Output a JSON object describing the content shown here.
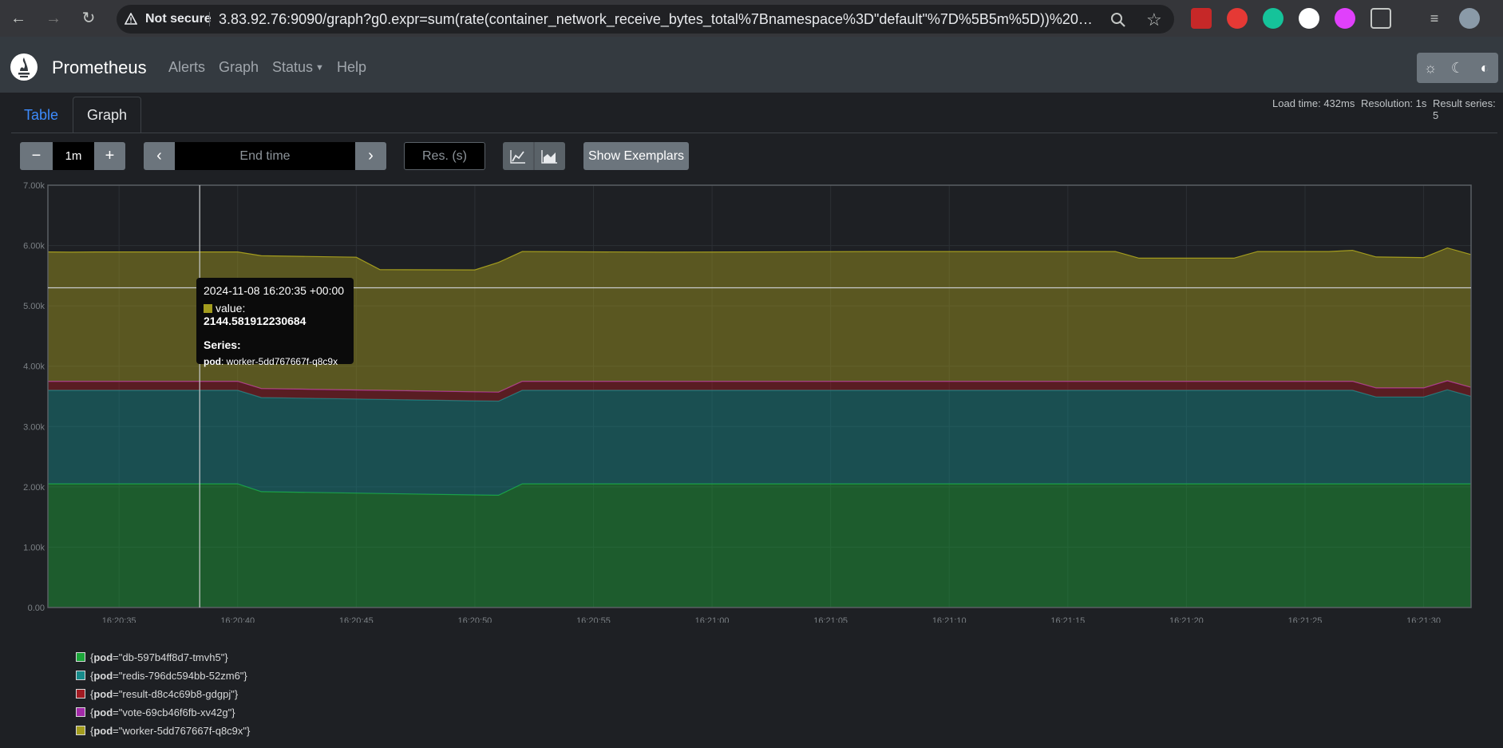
{
  "browser": {
    "security_label": "Not secure",
    "url": "3.83.92.76:9090/graph?g0.expr=sum(rate(container_network_receive_bytes_total%7Bnamespace%3D\"default\"%7D%5B5m%5D))%20by%20(p..."
  },
  "navbar": {
    "brand": "Prometheus",
    "links": [
      "Alerts",
      "Graph",
      "Status",
      "Help"
    ]
  },
  "tabs": {
    "table": "Table",
    "graph": "Graph"
  },
  "stats": {
    "load_time": "Load time: 432ms",
    "resolution": "Resolution: 1s",
    "result_series": "Result series: 5"
  },
  "controls": {
    "minus": "−",
    "range": "1m",
    "plus": "+",
    "prev": "‹",
    "end_time_placeholder": "End time",
    "next": "›",
    "res_placeholder": "Res. (s)",
    "show_exemplars": "Show Exemplars"
  },
  "tooltip": {
    "date": "2024-11-08 16:20:35 +00:00",
    "value_label": "value: ",
    "value": "2144.581912230684",
    "series_label": "Series:",
    "pod_key": "pod",
    "pod_value": "worker-5dd767667f-q8c9x"
  },
  "legend": [
    {
      "label_pre": "{",
      "key": "pod",
      "label_post": "=\"db-597b4ff8d7-tmvh5\"}",
      "color": "#1ca63a"
    },
    {
      "label_pre": "{",
      "key": "pod",
      "label_post": "=\"redis-796dc594bb-52zm6\"}",
      "color": "#168a8a"
    },
    {
      "label_pre": "{",
      "key": "pod",
      "label_post": "=\"result-d8c4c69b8-gdgpj\"}",
      "color": "#a11b22"
    },
    {
      "label_pre": "{",
      "key": "pod",
      "label_post": "=\"vote-69cb46f6fb-xv42g\"}",
      "color": "#a22aa8"
    },
    {
      "label_pre": "{",
      "key": "pod",
      "label_post": "=\"worker-5dd767667f-q8c9x\"}",
      "color": "#a39c1e"
    }
  ],
  "chart_data": {
    "type": "area",
    "stacked": true,
    "ylim": [
      0,
      7000
    ],
    "y_ticks": [
      "0.00",
      "1.00k",
      "2.00k",
      "3.00k",
      "4.00k",
      "5.00k",
      "6.00k",
      "7.00k"
    ],
    "x_ticks": [
      "16:20:35",
      "16:20:40",
      "16:20:45",
      "16:20:50",
      "16:20:55",
      "16:21:00",
      "16:21:05",
      "16:21:10",
      "16:21:15",
      "16:21:20",
      "16:21:25",
      "16:21:30"
    ],
    "x_seconds": [
      0,
      4,
      6,
      8,
      13,
      16,
      18,
      19,
      55,
      57,
      62,
      63,
      64,
      67,
      68,
      69
    ],
    "x_labels_seconds": [
      3,
      8,
      13,
      18,
      23,
      28,
      33,
      38,
      43,
      48,
      53,
      58
    ],
    "x_range_seconds": [
      0,
      60
    ],
    "crosshair": {
      "x_seconds": 6.4,
      "y": 5300
    },
    "series": [
      {
        "name": "{pod=\"db-597b4ff8d7-tmvh5\"}",
        "color": "#1ca63a",
        "x": [
          0,
          8,
          9,
          19,
          20,
          60
        ],
        "values": [
          2050,
          2050,
          1920,
          1860,
          2050,
          2050
        ]
      },
      {
        "name": "{pod=\"redis-796dc594bb-52zm6\"}",
        "color": "#168a8a",
        "x": [
          0,
          8,
          9,
          19,
          20,
          55,
          56,
          58,
          59,
          60
        ],
        "values": [
          1550,
          1550,
          1560,
          1560,
          1550,
          1550,
          1440,
          1440,
          1560,
          1450
        ]
      },
      {
        "name": "{pod=\"result-d8c4c69b8-gdgpj\"}",
        "color": "#a11b22",
        "x": [
          0,
          60
        ],
        "values": [
          150,
          150
        ]
      },
      {
        "name": "{pod=\"vote-69cb46f6fb-xv42g\"}",
        "color": "#a22aa8",
        "x": [
          0,
          60
        ],
        "values": [
          0,
          0
        ]
      },
      {
        "name": "{pod=\"worker-5dd767667f-q8c9x\"}",
        "color": "#a39c1e",
        "x": [
          0,
          1,
          2,
          8,
          9,
          13,
          14,
          18,
          19,
          20,
          26,
          35,
          45,
          46,
          50,
          51,
          54,
          55,
          56,
          58,
          59,
          60
        ],
        "values": [
          2144,
          2140,
          2144,
          2144,
          2200,
          2200,
          2000,
          2020,
          2150,
          2150,
          2140,
          2150,
          2150,
          2040,
          2040,
          2150,
          2150,
          2170,
          2170,
          2160,
          2200,
          2200
        ]
      }
    ]
  }
}
